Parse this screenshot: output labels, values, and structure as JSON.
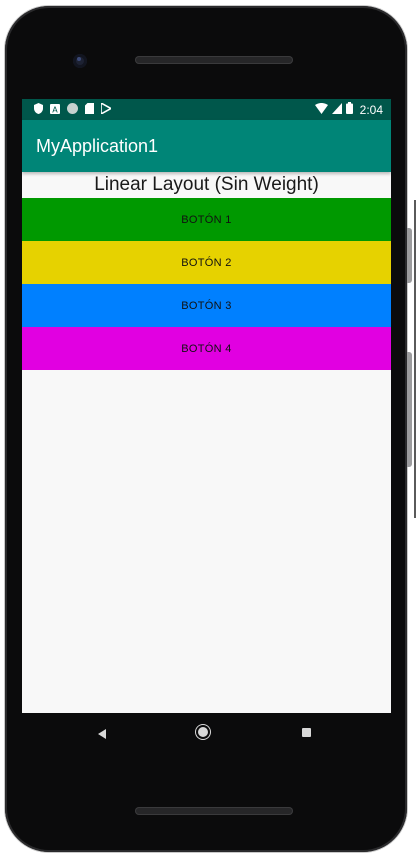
{
  "status_bar": {
    "time": "2:04",
    "icons": [
      "shield-icon",
      "a-icon",
      "circle-icon",
      "sd-card-icon",
      "play-store-icon"
    ],
    "right_icons": [
      "wifi-icon",
      "signal-icon",
      "battery-icon"
    ]
  },
  "app_bar": {
    "title": "MyApplication1",
    "color": "#008577"
  },
  "content": {
    "heading": "Linear Layout (Sin Weight)",
    "buttons": [
      {
        "label": "BOTÓN 1",
        "color": "#009900"
      },
      {
        "label": "BOTÓN 2",
        "color": "#e6d200"
      },
      {
        "label": "BOTÓN 3",
        "color": "#0080ff"
      },
      {
        "label": "BOTÓN 4",
        "color": "#e100e1"
      }
    ]
  },
  "nav_bar": {
    "icons": [
      "back-icon",
      "home-icon",
      "recents-icon"
    ]
  }
}
